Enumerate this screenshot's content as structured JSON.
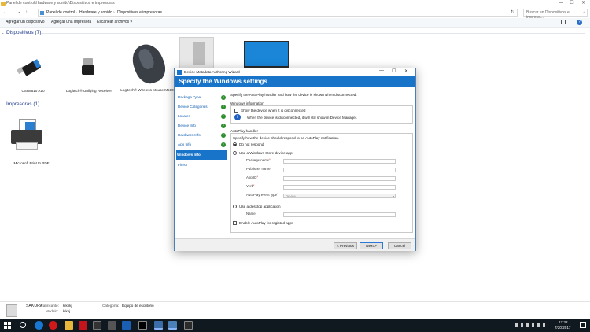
{
  "explorer": {
    "title_path": "Panel de control\\Hardware y sonido\\Dispositivos e impresoras",
    "window_controls": [
      "—",
      "☐",
      "✕"
    ],
    "breadcrumb": [
      "Panel de control",
      "Hardware y sonido",
      "Dispositivos e impresoras"
    ],
    "search_placeholder": "Buscar en Dispositivos e impreso...",
    "toolbar": {
      "add_device": "Agregar un dispositivo",
      "add_printer": "Agregar una impresora",
      "scan": "Escanear archivos ▾"
    },
    "devices_header": "Dispositivos (7)",
    "devices": [
      {
        "label": "CSR8510 A10"
      },
      {
        "label": "Logitech® Unifying Receiver"
      },
      {
        "label": "Logitech® Wireless Mouse M510"
      }
    ],
    "printers_header": "Impresoras (1)",
    "printers": [
      {
        "label": "Microsoft Print to PDF"
      }
    ],
    "details": {
      "name": "SAKURA",
      "manufacturer_label": "Fabricante:",
      "manufacturer_value": "kjkhkj",
      "model_label": "Modelo:",
      "model_value": "kjkhj",
      "category_label": "Categoría:",
      "category_value": "Equipo de escritorio"
    }
  },
  "taskbar": {
    "time": "17:32",
    "date": "7/20/2017"
  },
  "dialog": {
    "title": "Device Metadata Authoring Wizard",
    "header": "Specify the Windows settings",
    "steps": [
      {
        "label": "Package Type",
        "done": true
      },
      {
        "label": "Device Categories",
        "done": true
      },
      {
        "label": "Locales",
        "done": true
      },
      {
        "label": "Device Info",
        "done": true
      },
      {
        "label": "Hardware Info",
        "done": true
      },
      {
        "label": "App Info",
        "done": true
      },
      {
        "label": "Windows Info",
        "done": false,
        "active": true
      },
      {
        "label": "Finish",
        "done": false
      }
    ],
    "intro": "Specify the AutoPlay handler and how the device is shown when disconnected.",
    "windows_info": {
      "group_label": "Windows information",
      "show_disconnected": "Show the device when it is disconnected",
      "info_note": "When the device is disconnected, it will still show in Device Manager."
    },
    "autoplay": {
      "group_label": "AutoPlay handler",
      "description": "Specify how the device should respond to an AutoPlay notification.",
      "option_none": "Do not respond",
      "option_store": "Use a Windows Store device app",
      "package_name": "Package name",
      "publisher_name": "Publisher name",
      "app_id": "App ID",
      "verb": "Verb",
      "event_type": "AutoPlay event type",
      "event_type_value": "Device",
      "option_desktop": "Use a desktop application",
      "name": "Name",
      "enable_registered": "Enable AutoPlay for registed apps"
    },
    "buttons": {
      "previous": "< Previous",
      "next": "Next >",
      "cancel": "Cancel"
    }
  }
}
